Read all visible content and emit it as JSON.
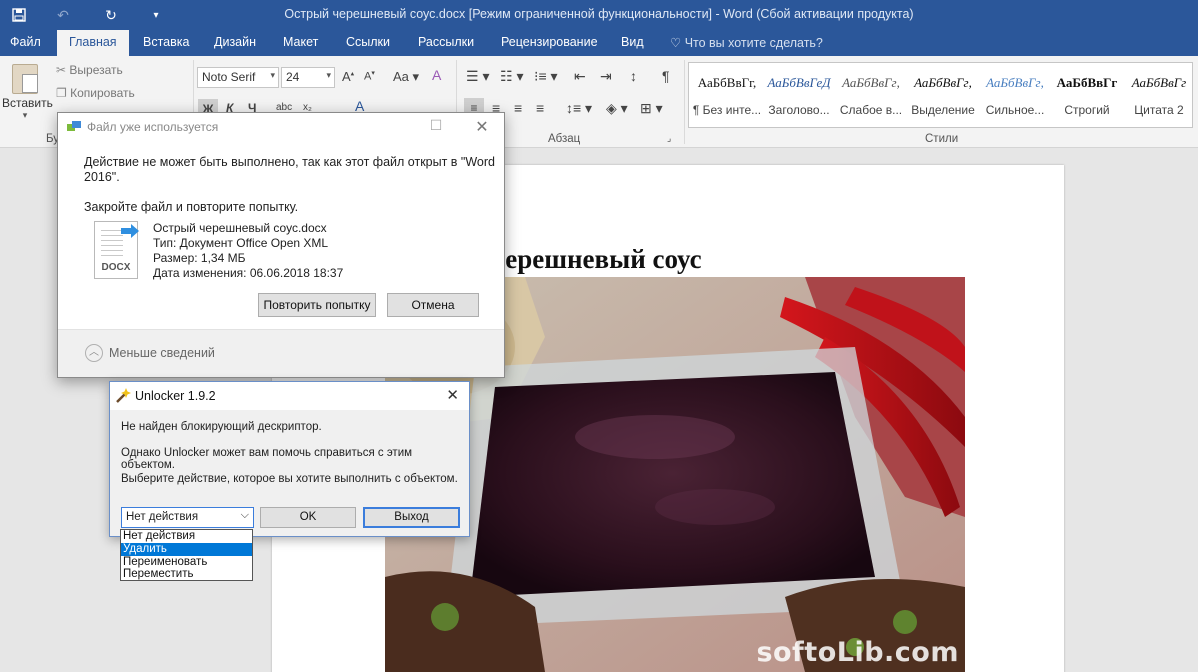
{
  "titlebar": {
    "title": "Острый черешневый соус.docx [Режим ограниченной функциональности] - Word (Сбой активации продукта)",
    "qa_icons": [
      "save-icon",
      "undo-icon",
      "redo-icon",
      "customize-icon"
    ]
  },
  "tabs": [
    {
      "label": "Файл"
    },
    {
      "label": "Главная"
    },
    {
      "label": "Вставка"
    },
    {
      "label": "Дизайн"
    },
    {
      "label": "Макет"
    },
    {
      "label": "Ссылки"
    },
    {
      "label": "Рассылки"
    },
    {
      "label": "Рецензирование"
    },
    {
      "label": "Вид"
    }
  ],
  "active_tab": "Главная",
  "tell_me": "Что вы хотите сделать?",
  "ribbon": {
    "paste_label": "Вставить",
    "cut_label": "Вырезать",
    "copy_label": "Копировать",
    "clipboard_group": "Бу",
    "font_name": "Noto Serif",
    "font_size": "24",
    "paragraph_group": "Абзац",
    "styles_group": "Стили",
    "styles": [
      {
        "sample": "АаБбВвГг,",
        "name": "¶ Без инте..."
      },
      {
        "sample": "АаБбВвГеД",
        "name": "Заголово..."
      },
      {
        "sample": "АаБбВвГг,",
        "name": "Слабое в..."
      },
      {
        "sample": "АаБбВвГг,",
        "name": "Выделение"
      },
      {
        "sample": "АаБбВвГг,",
        "name": "Сильное..."
      },
      {
        "sample": "АаБбВвГг",
        "name": "Строгий"
      },
      {
        "sample": "АаБбВвГг",
        "name": "Цитата 2"
      }
    ]
  },
  "document": {
    "heading": "черешневый соус"
  },
  "watermark": "softoLib.com",
  "file_in_use_dialog": {
    "caption": "Файл уже используется",
    "message": "Действие не может быть выполнено, так как этот файл открыт в \"Word 2016\".",
    "message_line1": "Действие не может быть выполнено, так как этот файл открыт в \"Word",
    "message_line2": "2016\".",
    "instruction": "Закройте файл и повторите попытку.",
    "file_ext": "DOCX",
    "file_name": "Острый черешневый соус.docx",
    "file_type": "Тип: Документ Office Open XML",
    "file_size": "Размер: 1,34 МБ",
    "file_modified": "Дата изменения: 06.06.2018 18:37",
    "retry_button": "Повторить попытку",
    "cancel_button": "Отмена",
    "less_details": "Меньше сведений"
  },
  "unlocker_dialog": {
    "title": "Unlocker 1.9.2",
    "line1": "Не найден блокирующий дескриптор.",
    "line2": "Однако Unlocker может вам помочь справиться с этим объектом.",
    "line3": "Выберите действие, которое вы хотите выполнить с объектом.",
    "selected_action": "Нет действия",
    "options": [
      "Нет действия",
      "Удалить",
      "Переименовать",
      "Переместить"
    ],
    "highlighted_option": "Удалить",
    "ok_button": "OK",
    "exit_button": "Выход"
  },
  "colors": {
    "word_blue": "#2b579a",
    "selection_blue": "#0078d7"
  }
}
